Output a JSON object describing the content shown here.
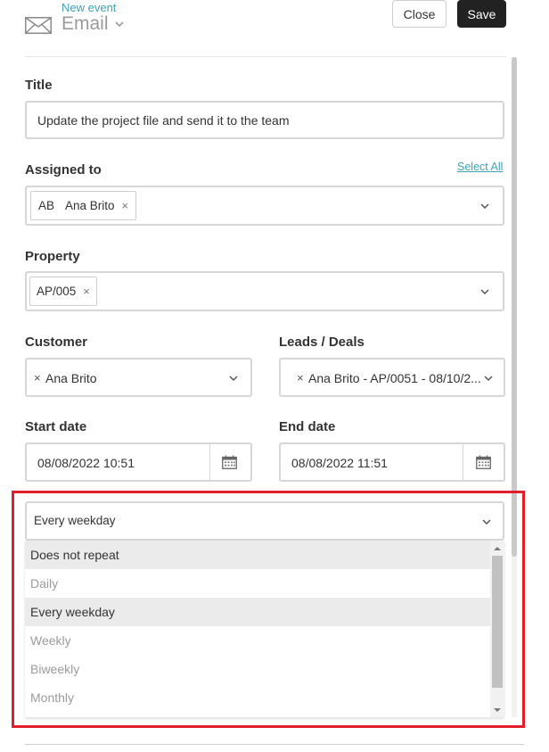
{
  "header": {
    "subtitle": "New event",
    "event_type": "Email",
    "close_label": "Close",
    "save_label": "Save",
    "icons": {
      "event_type": "envelope-icon",
      "type_dropdown": "chevron-down-icon"
    }
  },
  "form": {
    "title": {
      "label": "Title",
      "value": "Update the project file and send it to the team"
    },
    "assigned_to": {
      "label": "Assigned to",
      "select_all": "Select All",
      "tags": [
        {
          "initials": "AB",
          "name": "Ana Brito",
          "remove": "×"
        }
      ]
    },
    "property": {
      "label": "Property",
      "tags": [
        {
          "name": "AP/005",
          "remove": "×"
        }
      ]
    },
    "customer": {
      "label": "Customer",
      "remove": "×",
      "value": "Ana Brito"
    },
    "leads_deals": {
      "label": "Leads / Deals",
      "remove": "×",
      "value": "Ana Brito - AP/0051 - 08/10/2..."
    },
    "start_date": {
      "label": "Start date",
      "value": "08/08/2022 10:51",
      "icon": "calendar-icon"
    },
    "end_date": {
      "label": "End date",
      "value": "08/08/2022 11:51",
      "icon": "calendar-icon"
    },
    "repeat": {
      "selected": "Every weekday",
      "options": [
        {
          "label": "Does not repeat",
          "highlighted": true,
          "muted": false
        },
        {
          "label": "Daily",
          "highlighted": false,
          "muted": true
        },
        {
          "label": "Every weekday",
          "highlighted": true,
          "muted": false
        },
        {
          "label": "Weekly",
          "highlighted": false,
          "muted": true
        },
        {
          "label": "Biweekly",
          "highlighted": false,
          "muted": true
        },
        {
          "label": "Monthly",
          "highlighted": false,
          "muted": true
        }
      ]
    }
  },
  "colors": {
    "accent": "#3fa3b8",
    "save_button": "#222222",
    "focus_outline": "#e01f2a",
    "option_highlight": "#ebebeb"
  }
}
